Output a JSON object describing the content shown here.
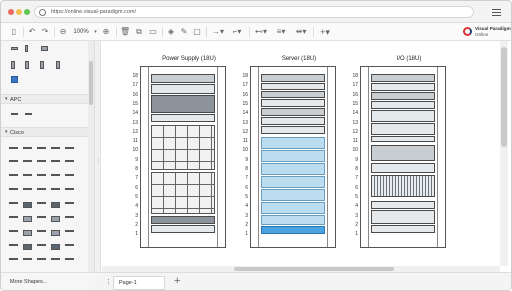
{
  "browser": {
    "url": "https://online.visual-paradigm.com/",
    "dot_colors": [
      "#ec6a5e",
      "#f4bf4f",
      "#61c554"
    ]
  },
  "toolbar": {
    "zoom_value": "100%",
    "brand_line1": "Visual Paradigm",
    "brand_line2": "Online"
  },
  "sidebar": {
    "categories": [
      {
        "label": "APC"
      },
      {
        "label": "Cisco"
      }
    ],
    "more_shapes": "More Shapes..."
  },
  "canvas": {
    "racks": [
      {
        "title": "Power Supply (18U)"
      },
      {
        "title": "Server (18U)"
      },
      {
        "title": "I/O (18U)"
      }
    ],
    "unit_numbers": [
      "18",
      "17",
      "16",
      "15",
      "14",
      "13",
      "12",
      "11",
      "10",
      "9",
      "8",
      "7",
      "6",
      "5",
      "4",
      "3",
      "2",
      "1"
    ]
  },
  "pagebar": {
    "page_tab": "Page-1",
    "add_label": "+"
  }
}
